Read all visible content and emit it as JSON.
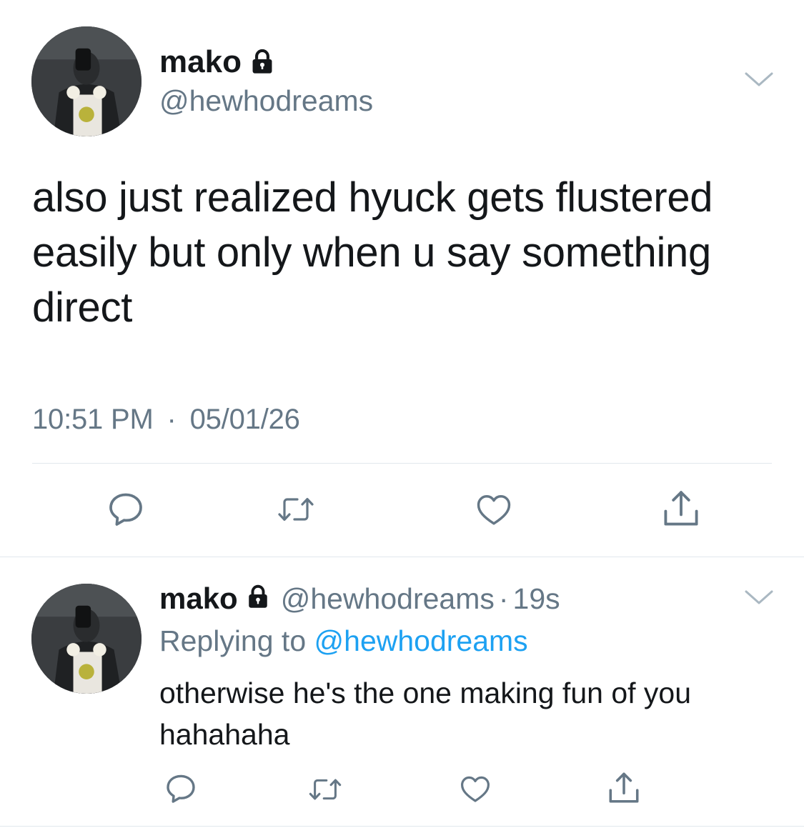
{
  "main_tweet": {
    "display_name": "mako",
    "handle": "@hewhodreams",
    "text": "also just realized hyuck gets flustered easily but only when u say something direct",
    "time": "10:51 PM",
    "separator": "·",
    "date": "05/01/26",
    "icons": [
      "lock-icon",
      "chevron-down-icon",
      "reply-icon",
      "retweet-icon",
      "like-icon",
      "share-icon"
    ]
  },
  "reply_tweet": {
    "display_name": "mako",
    "handle": "@hewhodreams",
    "separator": "·",
    "age": "19s",
    "replying_prefix": "Replying to",
    "replying_handle": "@hewhodreams",
    "text": "otherwise he's the one making fun of you hahahaha",
    "icons": [
      "lock-icon",
      "chevron-down-icon",
      "reply-icon",
      "retweet-icon",
      "like-icon",
      "share-icon"
    ]
  },
  "colors": {
    "text": "#14171a",
    "secondary": "#657786",
    "link": "#1da1f2",
    "divider": "#e1e8ed",
    "icon": "#657786"
  }
}
